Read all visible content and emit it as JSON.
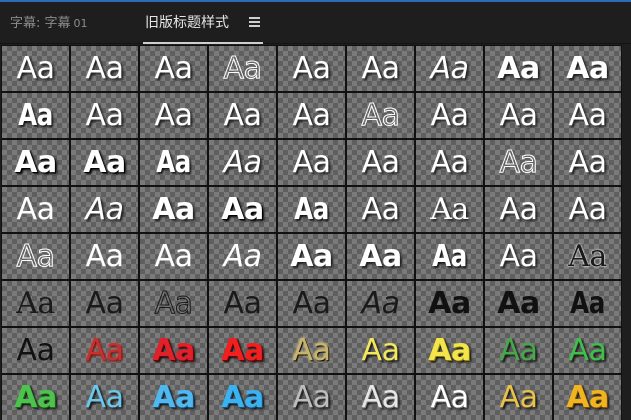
{
  "tabs": [
    {
      "label": "字幕: 字幕",
      "num": "01"
    },
    {
      "label": "旧版标题样式"
    }
  ],
  "menu_icon": "hamburger-menu-icon",
  "sample_text": "Aa",
  "styles": [
    {
      "color": "#ffffff",
      "font": "sans",
      "weight": "normal",
      "italic": false,
      "effect": "shadow"
    },
    {
      "color": "#ffffff",
      "font": "sans",
      "weight": "normal",
      "italic": false,
      "effect": "shadow"
    },
    {
      "color": "#ffffff",
      "font": "sans",
      "weight": "normal",
      "italic": false,
      "effect": "shadow"
    },
    {
      "color": "transparent",
      "font": "sans",
      "weight": "normal",
      "italic": false,
      "effect": "outline"
    },
    {
      "color": "#ffffff",
      "font": "sans",
      "weight": "normal",
      "italic": false,
      "effect": "shadow"
    },
    {
      "color": "#ffffff",
      "font": "sans",
      "weight": "normal",
      "italic": false,
      "effect": "shadow"
    },
    {
      "color": "#ffffff",
      "font": "sans",
      "weight": "normal",
      "italic": true,
      "effect": "shadow"
    },
    {
      "color": "#ffffff",
      "font": "sans",
      "weight": "bold",
      "italic": false,
      "effect": "shadow"
    },
    {
      "color": "#ffffff",
      "font": "sans",
      "weight": "bold",
      "italic": false,
      "effect": "shadow"
    },
    {
      "color": "#ffffff",
      "font": "sans",
      "weight": "bold",
      "italic": false,
      "effect": "condensed"
    },
    {
      "color": "#ffffff",
      "font": "sans",
      "weight": "normal",
      "italic": false,
      "effect": "shadow"
    },
    {
      "color": "#ffffff",
      "font": "sans",
      "weight": "normal",
      "italic": false,
      "effect": "shadow"
    },
    {
      "color": "#ffffff",
      "font": "sans",
      "weight": "normal",
      "italic": false,
      "effect": "shadow"
    },
    {
      "color": "#ffffff",
      "font": "sans",
      "weight": "normal",
      "italic": false,
      "effect": "shadow"
    },
    {
      "color": "transparent",
      "font": "sans",
      "weight": "normal",
      "italic": false,
      "effect": "outline"
    },
    {
      "color": "#ffffff",
      "font": "sans",
      "weight": "normal",
      "italic": false,
      "effect": "shadow"
    },
    {
      "color": "#ffffff",
      "font": "sans",
      "weight": "normal",
      "italic": false,
      "effect": "shadow"
    },
    {
      "color": "#ffffff",
      "font": "sans",
      "weight": "normal",
      "italic": false,
      "effect": "shadow"
    },
    {
      "color": "#ffffff",
      "font": "sans",
      "weight": "bold",
      "italic": false,
      "effect": "black"
    },
    {
      "color": "#ffffff",
      "font": "sans",
      "weight": "bold",
      "italic": false,
      "effect": "black"
    },
    {
      "color": "#ffffff",
      "font": "sans",
      "weight": "bold",
      "italic": false,
      "effect": "condensed"
    },
    {
      "color": "#ffffff",
      "font": "sans",
      "weight": "normal",
      "italic": true,
      "effect": "shadow"
    },
    {
      "color": "#ffffff",
      "font": "sans",
      "weight": "normal",
      "italic": false,
      "effect": "shadow"
    },
    {
      "color": "#ffffff",
      "font": "sans",
      "weight": "normal",
      "italic": false,
      "effect": "shadow"
    },
    {
      "color": "#ffffff",
      "font": "sans",
      "weight": "normal",
      "italic": false,
      "effect": "shadow"
    },
    {
      "color": "transparent",
      "font": "sans",
      "weight": "normal",
      "italic": false,
      "effect": "outline"
    },
    {
      "color": "#ffffff",
      "font": "sans",
      "weight": "normal",
      "italic": false,
      "effect": "shadow"
    },
    {
      "color": "#ffffff",
      "font": "sans",
      "weight": "normal",
      "italic": false,
      "effect": "plain"
    },
    {
      "color": "#ffffff",
      "font": "sans",
      "weight": "normal",
      "italic": true,
      "effect": "shadow"
    },
    {
      "color": "#ffffff",
      "font": "sans",
      "weight": "bold",
      "italic": false,
      "effect": "shadow"
    },
    {
      "color": "#ffffff",
      "font": "sans",
      "weight": "bold",
      "italic": false,
      "effect": "black"
    },
    {
      "color": "#ffffff",
      "font": "sans",
      "weight": "bold",
      "italic": false,
      "effect": "condensed"
    },
    {
      "color": "#ffffff",
      "font": "sans",
      "weight": "normal",
      "italic": false,
      "effect": "shadow"
    },
    {
      "color": "#ffffff",
      "font": "serif",
      "weight": "normal",
      "italic": false,
      "effect": "shadow"
    },
    {
      "color": "#ffffff",
      "font": "sans",
      "weight": "normal",
      "italic": false,
      "effect": "shadow"
    },
    {
      "color": "#ffffff",
      "font": "sans",
      "weight": "normal",
      "italic": false,
      "effect": "shadow"
    },
    {
      "color": "transparent",
      "font": "sans",
      "weight": "normal",
      "italic": false,
      "effect": "outline"
    },
    {
      "color": "#ffffff",
      "font": "sans",
      "weight": "normal",
      "italic": false,
      "effect": "plain"
    },
    {
      "color": "#ffffff",
      "font": "sans",
      "weight": "normal",
      "italic": false,
      "effect": "plain"
    },
    {
      "color": "#ffffff",
      "font": "sans",
      "weight": "normal",
      "italic": true,
      "effect": "plain"
    },
    {
      "color": "#ffffff",
      "font": "sans",
      "weight": "bold",
      "italic": false,
      "effect": "shadow"
    },
    {
      "color": "#ffffff",
      "font": "sans",
      "weight": "bold",
      "italic": false,
      "effect": "shadow"
    },
    {
      "color": "#ffffff",
      "font": "sans",
      "weight": "bold",
      "italic": false,
      "effect": "condensed"
    },
    {
      "color": "#ffffff",
      "font": "sans",
      "weight": "normal",
      "italic": false,
      "effect": "shadow"
    },
    {
      "color": "#1a1a1a",
      "font": "serif",
      "weight": "normal",
      "italic": false,
      "effect": "whiteglow"
    },
    {
      "color": "#1a1a1a",
      "font": "serif",
      "weight": "normal",
      "italic": false,
      "effect": "plain"
    },
    {
      "color": "#1a1a1a",
      "font": "sans",
      "weight": "normal",
      "italic": false,
      "effect": "plain"
    },
    {
      "color": "transparent",
      "font": "sans",
      "weight": "normal",
      "italic": false,
      "effect": "darkoutline"
    },
    {
      "color": "#1a1a1a",
      "font": "sans",
      "weight": "normal",
      "italic": false,
      "effect": "plain"
    },
    {
      "color": "#1a1a1a",
      "font": "sans",
      "weight": "normal",
      "italic": false,
      "effect": "plain"
    },
    {
      "color": "#1a1a1a",
      "font": "sans",
      "weight": "normal",
      "italic": true,
      "effect": "plain"
    },
    {
      "color": "#111111",
      "font": "sans",
      "weight": "bold",
      "italic": false,
      "effect": "plain"
    },
    {
      "color": "#111111",
      "font": "sans",
      "weight": "bold",
      "italic": false,
      "effect": "plain"
    },
    {
      "color": "#111111",
      "font": "sans",
      "weight": "bold",
      "italic": false,
      "effect": "condensed-dark"
    },
    {
      "color": "#111111",
      "font": "sans",
      "weight": "normal",
      "italic": false,
      "effect": "plain"
    },
    {
      "color": "#c8302c",
      "font": "sans",
      "weight": "normal",
      "italic": false,
      "effect": "redglow"
    },
    {
      "color": "#e0202a",
      "font": "sans",
      "weight": "bold",
      "italic": false,
      "effect": "redbevel"
    },
    {
      "color": "#f02020",
      "font": "sans",
      "weight": "bold",
      "italic": false,
      "effect": "redbevel"
    },
    {
      "color": "#c9b36a",
      "font": "sans",
      "weight": "normal",
      "italic": false,
      "effect": "goldglow"
    },
    {
      "color": "#f2e85a",
      "font": "sans",
      "weight": "normal",
      "italic": false,
      "effect": "darkshadow"
    },
    {
      "color": "#f2e44a",
      "font": "sans",
      "weight": "bold",
      "italic": false,
      "effect": "yellowbevel"
    },
    {
      "color": "#47a84a",
      "font": "sans",
      "weight": "normal",
      "italic": false,
      "effect": "darkshadow"
    },
    {
      "color": "#3fc04a",
      "font": "sans",
      "weight": "normal",
      "italic": false,
      "effect": "darkshadow"
    },
    {
      "color": "#4cc44c",
      "font": "sans",
      "weight": "bold",
      "italic": false,
      "effect": "greenbevel"
    },
    {
      "color": "#6cc7ee",
      "font": "sans",
      "weight": "normal",
      "italic": false,
      "effect": "darkshadow"
    },
    {
      "color": "#4fb8ee",
      "font": "sans",
      "weight": "bold",
      "italic": false,
      "effect": "bluebevel"
    },
    {
      "color": "#3ab2f0",
      "font": "sans",
      "weight": "bold",
      "italic": false,
      "effect": "bluebevel"
    },
    {
      "color": "#bdbdbd",
      "font": "sans",
      "weight": "normal",
      "italic": false,
      "effect": "darkshadow"
    },
    {
      "color": "#e6e6e6",
      "font": "sans",
      "weight": "normal",
      "italic": false,
      "effect": "silver"
    },
    {
      "color": "#ffffff",
      "font": "sans",
      "weight": "normal",
      "italic": false,
      "effect": "silver"
    },
    {
      "color": "#e8c24a",
      "font": "sans",
      "weight": "normal",
      "italic": false,
      "effect": "darkshadow"
    },
    {
      "color": "#f0b422",
      "font": "sans",
      "weight": "bold",
      "italic": false,
      "effect": "goldbevel"
    }
  ]
}
